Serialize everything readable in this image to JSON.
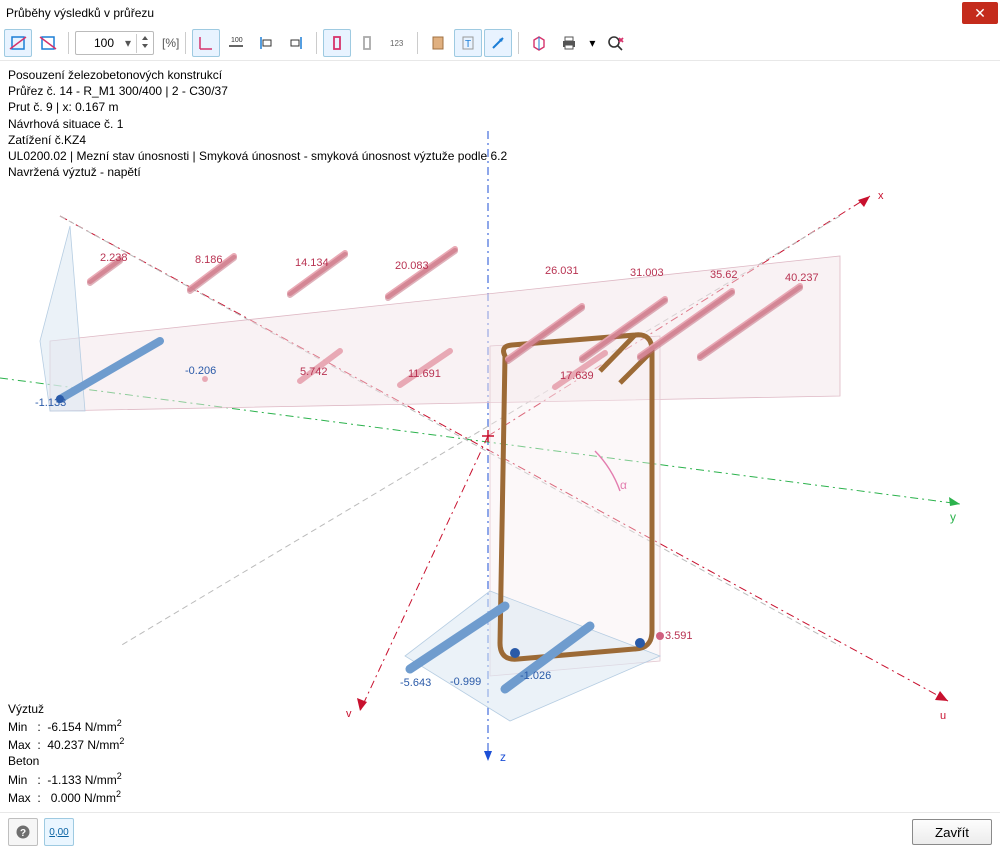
{
  "window": {
    "title": "Průběhy výsledků v průřezu",
    "close_label": "✕"
  },
  "toolbar": {
    "zoom": "100",
    "zoom_unit": "[%]"
  },
  "info": {
    "l1": "Posouzení železobetonových konstrukcí",
    "l2": "Průřez č. 14 - R_M1 300/400 | 2 - C30/37",
    "l3": "Prut č. 9 | x: 0.167 m",
    "l4": "Návrhová situace č. 1",
    "l5": "Zatížení č.KZ4",
    "l6": "UL0200.02 | Mezní stav únosnosti | Smyková únosnost - smyková únosnost výztuže podle 6.2",
    "l7": "Navržená výztuž - napětí"
  },
  "chart_data": {
    "type": "scatter",
    "series": [
      {
        "name": "top_bars",
        "values": [
          2.238,
          8.186,
          14.134,
          20.083,
          26.031,
          31.003,
          35.62,
          40.237
        ]
      },
      {
        "name": "mid_bars",
        "values": [
          -0.206,
          5.742,
          11.691,
          17.639
        ]
      },
      {
        "name": "bottom_bars",
        "values": [
          -1.133,
          -5.643,
          -0.999,
          -1.026,
          3.591
        ]
      }
    ],
    "axis_labels": {
      "x": "x",
      "y": "y",
      "z": "z",
      "u": "u",
      "v": "v",
      "alpha": "α"
    }
  },
  "legend": {
    "reinf_title": "Výztuž",
    "reinf_min_label": "Min",
    "reinf_min_value": "-6.154 N/mm",
    "reinf_max_label": "Max",
    "reinf_max_value": "40.237 N/mm",
    "conc_title": "Beton",
    "conc_min_label": "Min",
    "conc_min_value": "-1.133 N/mm",
    "conc_max_label": "Max",
    "conc_max_value": "0.000 N/mm",
    "sq": "2"
  },
  "footer": {
    "close": "Zavřít",
    "units_btn": "0,00"
  }
}
